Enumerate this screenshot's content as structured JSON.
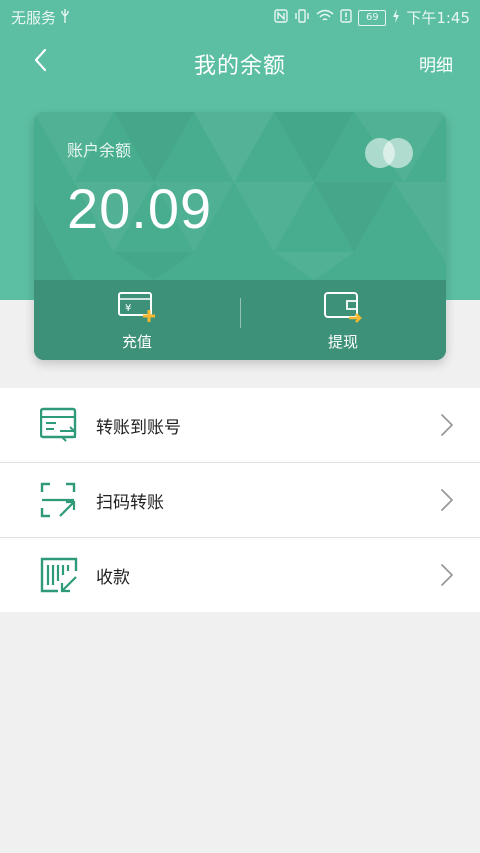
{
  "status_bar": {
    "carrier": "无服务",
    "time": "下午1:45",
    "battery": "69",
    "icons": [
      "usb-icon",
      "nfc-icon",
      "vibrate-icon",
      "wifi-icon",
      "sim-alert-icon",
      "battery-icon",
      "charging-icon"
    ]
  },
  "nav": {
    "back_icon": "chevron-left-icon",
    "title": "我的余额",
    "detail_label": "明细"
  },
  "card": {
    "balance_label": "账户余额",
    "balance_amount": "20.09",
    "actions": [
      {
        "label": "充值",
        "icon": "recharge-card-icon"
      },
      {
        "label": "提现",
        "icon": "withdraw-wallet-icon"
      }
    ]
  },
  "menu": [
    {
      "label": "转账到账号",
      "icon": "transfer-account-icon"
    },
    {
      "label": "扫码转账",
      "icon": "scan-transfer-icon"
    },
    {
      "label": "收款",
      "icon": "receive-payment-icon"
    }
  ],
  "colors": {
    "primary": "#5cbfa3",
    "card": "#48ad8f",
    "card_bottom": "#3d9178",
    "accent_yellow": "#f5b82e",
    "icon_green": "#2f9a7a",
    "background": "#f0f0f0"
  }
}
